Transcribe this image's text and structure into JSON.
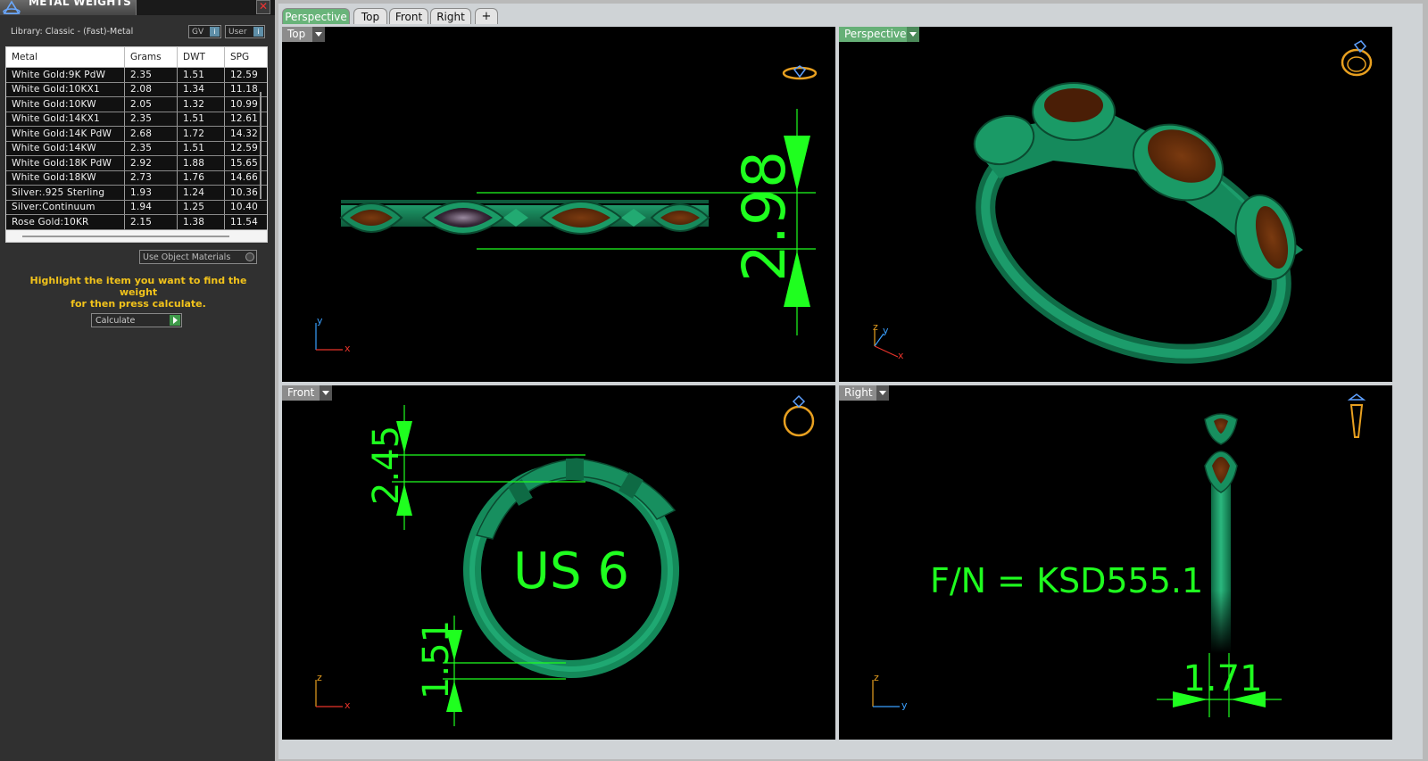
{
  "panel": {
    "title": "METAL WEIGHTS",
    "library_label": "Library: Classic - (Fast)-Metal",
    "gv_label": "GV",
    "user_label": "User",
    "table": {
      "headers": [
        "Metal",
        "Grams",
        "DWT",
        "SPG"
      ],
      "rows": [
        [
          "White Gold:9K PdW",
          "2.35",
          "1.51",
          "12.59"
        ],
        [
          "White Gold:10KX1",
          "2.08",
          "1.34",
          "11.18"
        ],
        [
          "White Gold:10KW",
          "2.05",
          "1.32",
          "10.99"
        ],
        [
          "White Gold:14KX1",
          "2.35",
          "1.51",
          "12.61"
        ],
        [
          "White Gold:14K PdW",
          "2.68",
          "1.72",
          "14.32"
        ],
        [
          "White Gold:14KW",
          "2.35",
          "1.51",
          "12.59"
        ],
        [
          "White Gold:18K PdW",
          "2.92",
          "1.88",
          "15.65"
        ],
        [
          "White Gold:18KW",
          "2.73",
          "1.76",
          "14.66"
        ],
        [
          "Silver:.925 Sterling",
          "1.93",
          "1.24",
          "10.36"
        ],
        [
          "Silver:Continuum",
          "1.94",
          "1.25",
          "10.40"
        ],
        [
          "Rose Gold:10KR",
          "2.15",
          "1.38",
          "11.54"
        ]
      ]
    },
    "use_object_materials_label": "Use Object Materials",
    "instructions_line1": "Highlight the item you want to find the weight",
    "instructions_line2": "for then press calculate.",
    "calculate_label": "Calculate"
  },
  "tabs": [
    {
      "label": "Perspective",
      "active": true
    },
    {
      "label": "Top",
      "active": false
    },
    {
      "label": "Front",
      "active": false
    },
    {
      "label": "Right",
      "active": false
    },
    {
      "label": "+",
      "active": false
    }
  ],
  "viewports": {
    "top": {
      "label": "Top",
      "dimension": "2.98",
      "axis_v": "y",
      "axis_h": "x"
    },
    "perspective": {
      "label": "Perspective",
      "axis_z": "z",
      "axis_y": "y",
      "axis_x": "x"
    },
    "front": {
      "label": "Front",
      "dim_upper": "2.45",
      "dim_lower": "1.51",
      "size_text": "US 6",
      "axis_v": "z",
      "axis_h": "x"
    },
    "right": {
      "label": "Right",
      "dimension": "1.71",
      "part_number": "F/N = KSD555.1",
      "axis_v": "z",
      "axis_h": "y"
    }
  },
  "colors": {
    "dimension_green": "#1fff1f",
    "model_green": "#1b8a5e",
    "gem_brown": "#5a2a0a",
    "active_tab": "#69b47a",
    "instruction_yellow": "#f2c31b",
    "orientation_icon": "#e8a020"
  }
}
